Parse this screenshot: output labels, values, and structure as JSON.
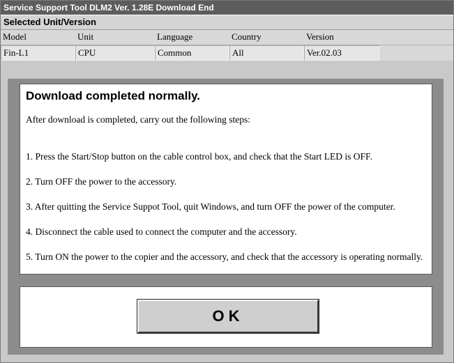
{
  "window": {
    "title": "Service Support Tool DLM2 Ver. 1.28E  Download End"
  },
  "selected_unit": {
    "header": "Selected Unit/Version",
    "columns": [
      "Model",
      "Unit",
      "Language",
      "Country",
      "Version"
    ],
    "values": [
      "Fin-L1",
      "CPU",
      "Common",
      "All",
      "Ver.02.03"
    ]
  },
  "message": {
    "title": "Download completed normally.",
    "intro": "After download is completed, carry out the following steps:",
    "steps": [
      "1. Press the Start/Stop button on the cable control box, and check that the Start LED is OFF.",
      "2. Turn OFF the power to the accessory.",
      "3. After quitting the Service Suppot Tool, quit Windows, and turn OFF the power of the computer.",
      "4. Disconnect the cable used to connect the computer and the accessory.",
      "5. Turn ON the power to the copier and the accessory, and check that the accessory is operating normally."
    ]
  },
  "ok_button": {
    "label": "OK"
  }
}
